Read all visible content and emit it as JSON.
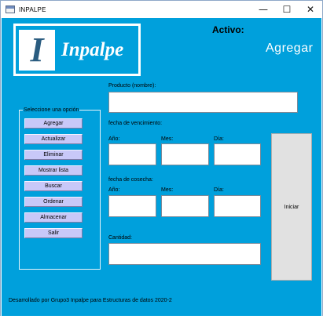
{
  "window": {
    "title": "INPALPE",
    "controls": {
      "minimize": "—",
      "maximize": "☐",
      "close": "✕"
    }
  },
  "logo": {
    "mark": "I",
    "text": "Inpalpe"
  },
  "status": {
    "label": "Activo:",
    "value": "Agregar"
  },
  "form": {
    "producto_label": "Producto (nombre):",
    "vencimiento_label": "fecha de vencimiento:",
    "cosecha_label": "fecha de cosecha:",
    "anio_label": "Año:",
    "mes_label": "Mes:",
    "dia_label": "Día:",
    "cantidad_label": "Cantidad:",
    "producto_value": "",
    "venc_anio_value": "",
    "venc_mes_value": "",
    "venc_dia_value": "",
    "cos_anio_value": "",
    "cos_mes_value": "",
    "cos_dia_value": "",
    "cantidad_value": ""
  },
  "menu": {
    "title": "Seleccione una opción",
    "items": [
      "Agregar",
      "Actualizar",
      "Eliminar",
      "Mostrar lista",
      "Buscar",
      "Ordenar",
      "Almacenar",
      "Salir"
    ]
  },
  "iniciar_label": "Iniciar",
  "footer": "Desarrollado por Grupo3 Inpalpe para Estructuras de datos 2020-2",
  "colors": {
    "background": "#00a0dc",
    "menu_button": "#c8c8f8",
    "logo_mark_text": "#2a5c80"
  }
}
